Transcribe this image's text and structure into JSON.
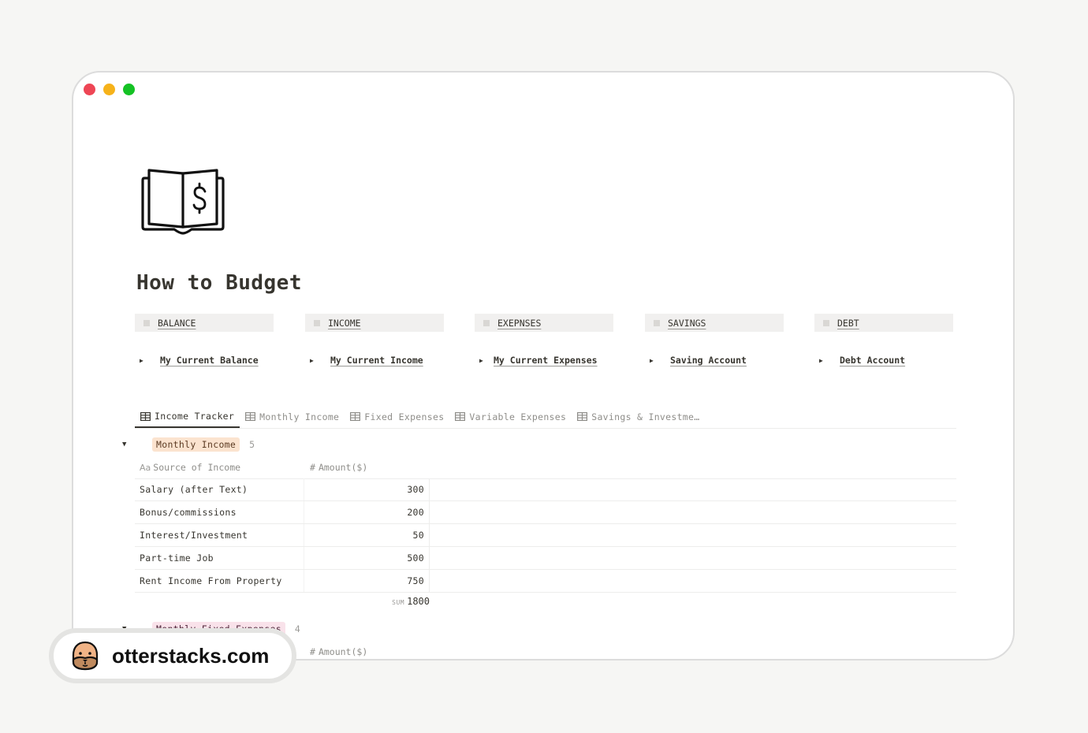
{
  "window": {
    "controls": [
      "close",
      "minimize",
      "maximize"
    ]
  },
  "page": {
    "icon": "book-dollar-icon",
    "title": "How to Budget"
  },
  "callouts": [
    {
      "label": "BALANCE"
    },
    {
      "label": "INCOME"
    },
    {
      "label": "EXEPNSES"
    },
    {
      "label": "SAVINGS"
    },
    {
      "label": "DEBT"
    }
  ],
  "toggles": [
    {
      "label": "My Current Balance"
    },
    {
      "label": "My Current Income"
    },
    {
      "label": "My Current Expenses"
    },
    {
      "label": "Saving Account"
    },
    {
      "label": "Debt Account"
    }
  ],
  "tabs": [
    {
      "label": "Income Tracker",
      "active": true,
      "icon": "table-icon"
    },
    {
      "label": "Monthly Income",
      "active": false,
      "icon": "table-icon"
    },
    {
      "label": "Fixed Expenses",
      "active": false,
      "icon": "table-icon"
    },
    {
      "label": "Variable Expenses",
      "active": false,
      "icon": "table-icon"
    },
    {
      "label": "Savings & Investme…",
      "active": false,
      "icon": "table-icon"
    }
  ],
  "groups": [
    {
      "name": "Monthly Income",
      "count": "5",
      "color": "#fbe3cf",
      "columns": {
        "source": "Source of Income",
        "source_icon": "Aa",
        "amount": "Amount($)",
        "amount_icon": "#"
      },
      "rows": [
        {
          "source": "Salary (after Text)",
          "amount": "300"
        },
        {
          "source": "Bonus/commissions",
          "amount": "200"
        },
        {
          "source": "Interest/Investment",
          "amount": "50"
        },
        {
          "source": "Part-time Job",
          "amount": "500"
        },
        {
          "source": "Rent Income From Property",
          "amount": "750"
        }
      ],
      "sum_label": "SUM",
      "sum_value": "1800"
    },
    {
      "name": "Monthly Fixed Expenses",
      "count": "4",
      "color": "#f9e2ea",
      "columns": {
        "amount": "Amount($)",
        "amount_icon": "#"
      }
    }
  ],
  "badge": {
    "site": "otterstacks.com",
    "icon": "otter-face-icon"
  }
}
